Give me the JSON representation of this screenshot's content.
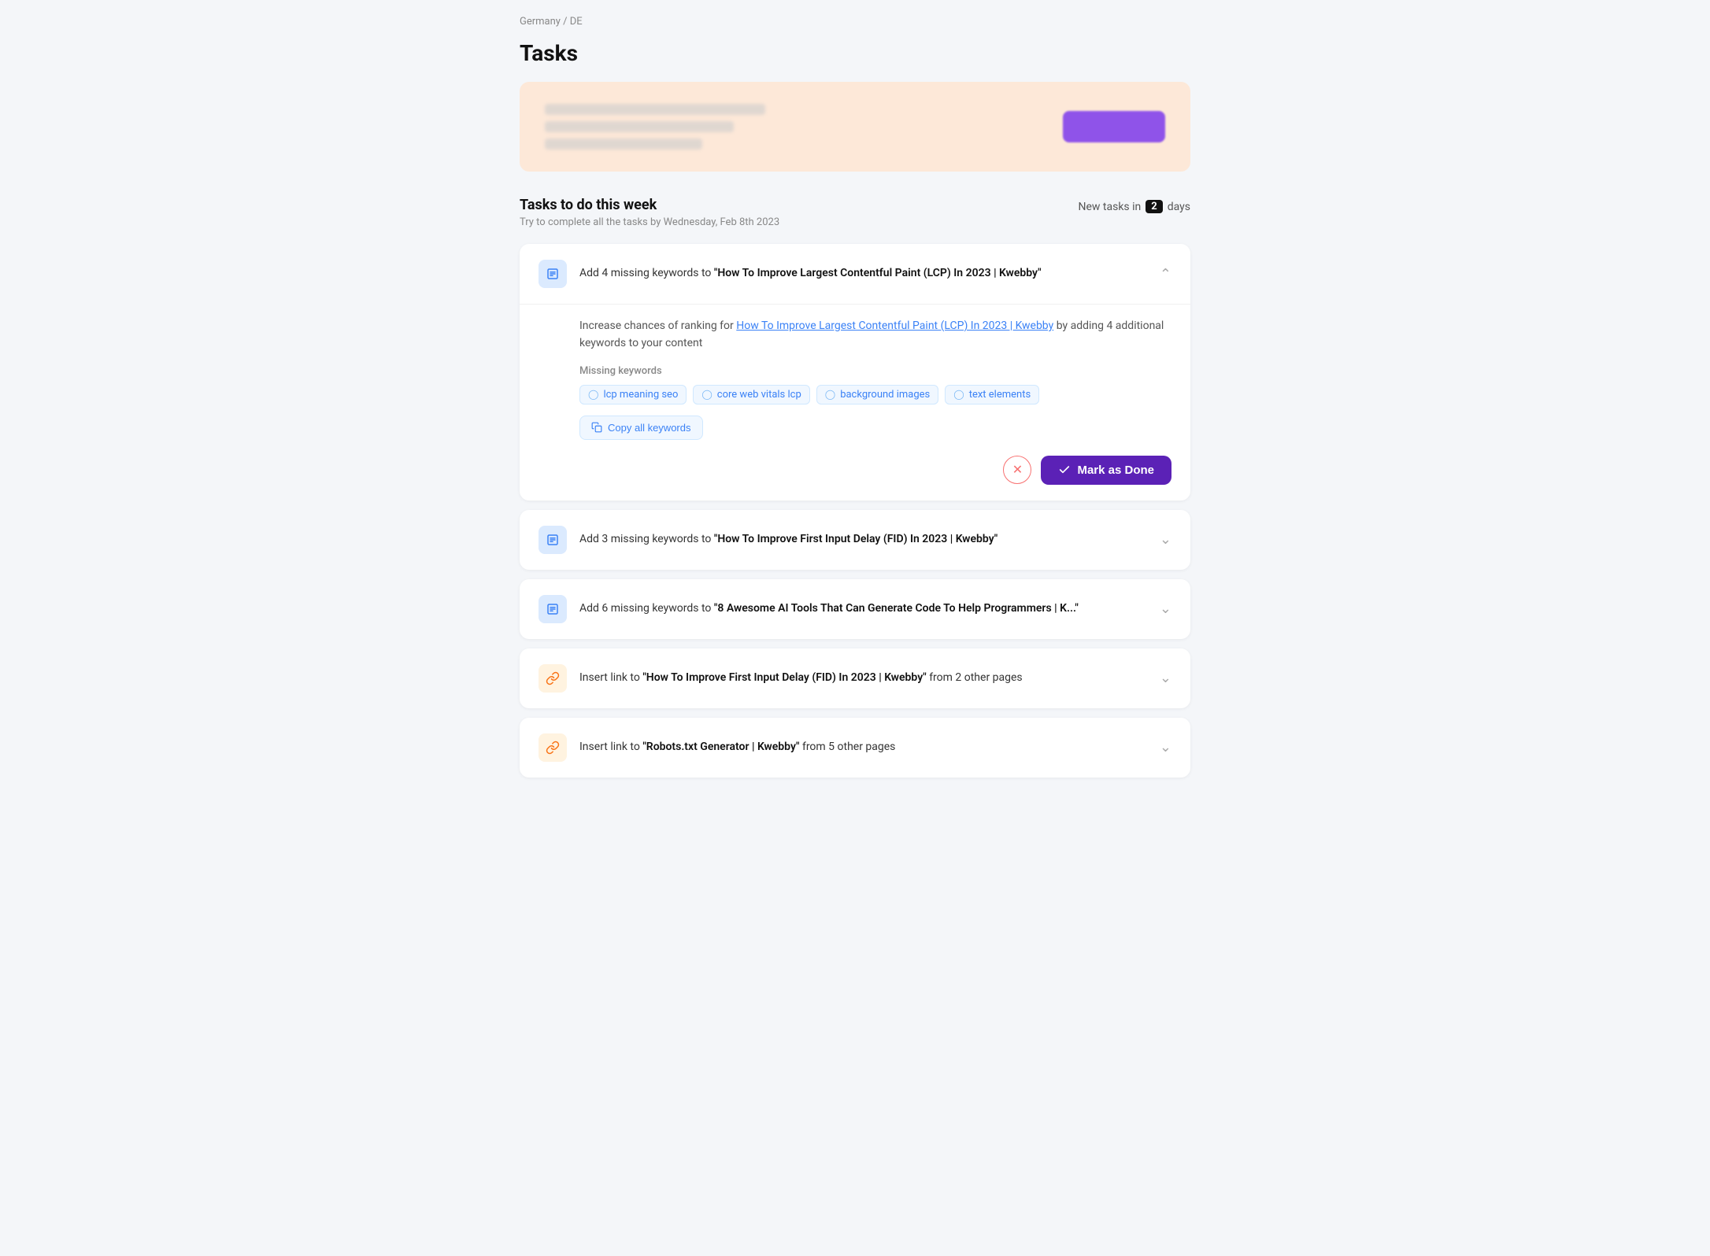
{
  "breadcrumb": "Germany / DE",
  "page": {
    "title": "Tasks",
    "section_title": "Tasks to do this week",
    "section_subtitle": "Try to complete all the tasks by Wednesday, Feb 8th 2023",
    "new_tasks_prefix": "New tasks in",
    "new_tasks_count": "2",
    "new_tasks_suffix": "days"
  },
  "promo": {
    "button_label": ""
  },
  "tasks": [
    {
      "id": "task-1",
      "icon_type": "keyword",
      "title_prefix": "Add 4 missing keywords to ",
      "title_link": "\"How To Improve Largest Contentful Paint (LCP) In 2023 | Kwebby\"",
      "expanded": true,
      "description_prefix": "Increase chances of ranking for ",
      "description_link": "How To Improve Largest Contentful Paint (LCP) In 2023 | Kwebby",
      "description_suffix": " by adding 4 additional keywords to your content",
      "missing_keywords_label": "Missing keywords",
      "keywords": [
        "lcp meaning seo",
        "core web vitals lcp",
        "background images",
        "text elements"
      ],
      "copy_label": "Copy all keywords",
      "mark_done_label": "Mark as Done"
    },
    {
      "id": "task-2",
      "icon_type": "keyword",
      "title_prefix": "Add 3 missing keywords to ",
      "title_link": "\"How To Improve First Input Delay (FID) In 2023 | Kwebby\"",
      "expanded": false
    },
    {
      "id": "task-3",
      "icon_type": "keyword",
      "title_prefix": "Add 6 missing keywords to ",
      "title_link": "\"8 Awesome AI Tools That Can Generate Code To Help Programmers | K...\"",
      "expanded": false
    },
    {
      "id": "task-4",
      "icon_type": "link",
      "title_prefix": "Insert link to ",
      "title_link": "\"How To Improve First Input Delay (FID) In 2023 | Kwebby\"",
      "title_suffix": " from 2 other pages",
      "expanded": false
    },
    {
      "id": "task-5",
      "icon_type": "link",
      "title_prefix": "Insert link to ",
      "title_link": "\"Robots.txt Generator | Kwebby\"",
      "title_suffix": " from 5 other pages",
      "expanded": false
    }
  ]
}
